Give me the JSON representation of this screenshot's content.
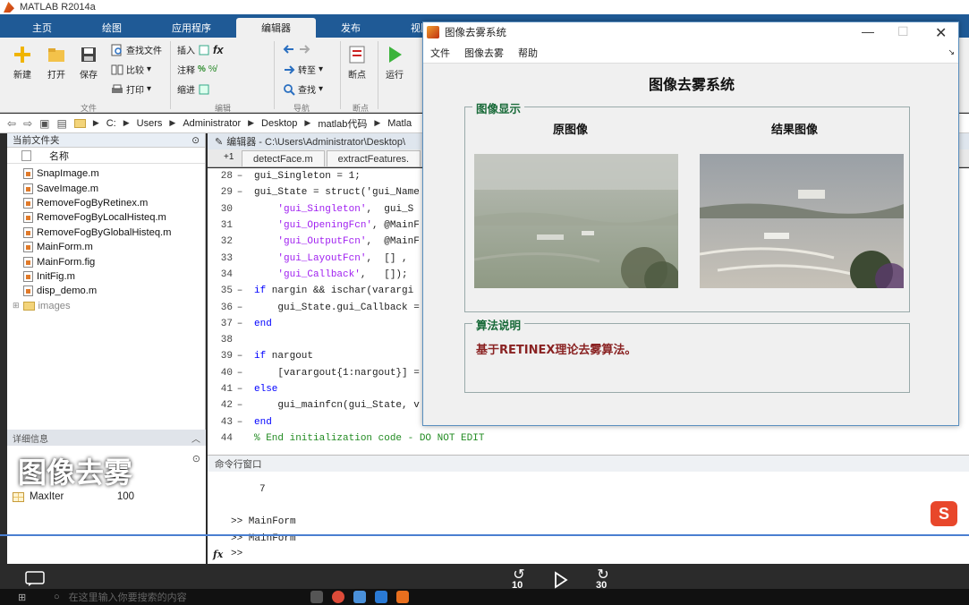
{
  "window": {
    "title": "MATLAB R2014a"
  },
  "tabs": [
    "主页",
    "绘图",
    "应用程序",
    "编辑器",
    "发布",
    "视图"
  ],
  "active_tab": "编辑器",
  "ribbon": {
    "new": "新建",
    "open": "打开",
    "save": "保存",
    "find_files": "查找文件",
    "compare": "比较",
    "print": "打印",
    "insert": "插入",
    "comment": "注释",
    "indent": "缩进",
    "goto": "转至",
    "find": "查找",
    "breakpoint": "断点",
    "run": "运行",
    "sec_file": "文件",
    "sec_edit": "编辑",
    "sec_nav": "导航",
    "sec_bp": "断点",
    "fx": "fx"
  },
  "path": {
    "crumbs": [
      "C:",
      "Users",
      "Administrator",
      "Desktop",
      "matlab代码",
      "Matla"
    ]
  },
  "left_panel": {
    "title": "当前文件夹",
    "col_name": "名称",
    "files": [
      "SnapImage.m",
      "SaveImage.m",
      "RemoveFogByRetinex.m",
      "RemoveFogByLocalHisteq.m",
      "RemoveFogByGlobalHisteq.m",
      "MainForm.m",
      "MainForm.fig",
      "InitFig.m",
      "disp_demo.m"
    ],
    "folder": "images"
  },
  "detail_panel": {
    "title": "详细信息"
  },
  "caption": "图像去雾",
  "workspace": {
    "var_name": "MaxIter",
    "var_value": "100"
  },
  "editor": {
    "header": "编辑器 - C:\\Users\\Administrator\\Desktop\\",
    "tabs": [
      "detectFace.m",
      "extractFeatures."
    ],
    "plus": "+1",
    "lines": [
      {
        "n": "28",
        "d": "–",
        "t": "gui_Singleton = 1;"
      },
      {
        "n": "29",
        "d": "–",
        "t": "gui_State = struct('gui_Name"
      },
      {
        "n": "30",
        "d": "",
        "t": "    'gui_Singleton',  gui_S"
      },
      {
        "n": "31",
        "d": "",
        "t": "    'gui_OpeningFcn', @MainF"
      },
      {
        "n": "32",
        "d": "",
        "t": "    'gui_OutputFcn',  @MainF"
      },
      {
        "n": "33",
        "d": "",
        "t": "    'gui_LayoutFcn',  [] , "
      },
      {
        "n": "34",
        "d": "",
        "t": "    'gui_Callback',   []);"
      },
      {
        "n": "35",
        "d": "–",
        "t": "if nargin && ischar(varargi"
      },
      {
        "n": "36",
        "d": "–",
        "t": "    gui_State.gui_Callback ="
      },
      {
        "n": "37",
        "d": "–",
        "t": "end"
      },
      {
        "n": "38",
        "d": "",
        "t": ""
      },
      {
        "n": "39",
        "d": "–",
        "t": "if nargout"
      },
      {
        "n": "40",
        "d": "–",
        "t": "    [varargout{1:nargout}] ="
      },
      {
        "n": "41",
        "d": "–",
        "t": "else"
      },
      {
        "n": "42",
        "d": "–",
        "t": "    gui_mainfcn(gui_State, v"
      },
      {
        "n": "43",
        "d": "–",
        "t": "end"
      },
      {
        "n": "44",
        "d": "",
        "t": "% End initialization code - DO NOT EDIT"
      }
    ]
  },
  "command_window": {
    "title": "命令行窗口",
    "out1": "7",
    "out2": ">> MainForm",
    "out3": ">> MainForm",
    "prompt": ">>",
    "fx": "fx"
  },
  "gui": {
    "title": "图像去雾系统",
    "menu": [
      "文件",
      "图像去雾",
      "帮助"
    ],
    "heading": "图像去雾系统",
    "panel1_title": "图像显示",
    "orig_caption": "原图像",
    "result_caption": "结果图像",
    "panel2_title": "算法说明",
    "algo_text": "基于RETINEX理论去雾算法。"
  },
  "player": {
    "rewind": "10",
    "forward": "30"
  },
  "taskbar": {
    "search": "在这里输入你要搜索的内容"
  },
  "colors": {
    "matlab_tab": "#1f5a96",
    "legend_green": "#1a6b3a",
    "algo_red": "#8a2323",
    "progress": "#4a7fd0"
  }
}
